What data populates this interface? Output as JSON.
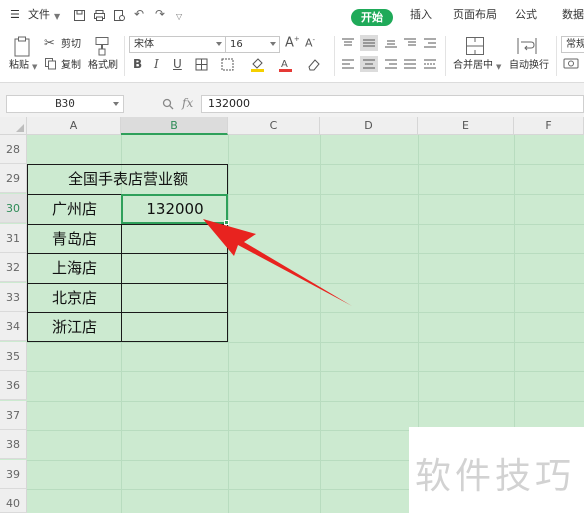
{
  "menubar": {
    "file_label": "文件",
    "tabs": [
      "开始",
      "插入",
      "页面布局",
      "公式",
      "数据"
    ]
  },
  "ribbon": {
    "paste_label": "粘贴",
    "cut_label": "剪切",
    "copy_label": "复制",
    "format_painter_label": "格式刷",
    "font_name": "宋体",
    "font_size": "16",
    "merge_center_label": "合并居中",
    "wrap_text_label": "自动换行",
    "number_format": "常规"
  },
  "formula_bar": {
    "name_box": "B30",
    "fx_label": "fx",
    "formula_value": "132000"
  },
  "columns": [
    "A",
    "B",
    "C",
    "D",
    "E",
    "F"
  ],
  "rows": [
    "28",
    "29",
    "30",
    "31",
    "32",
    "33",
    "34",
    "35",
    "36",
    "37",
    "38",
    "39",
    "40"
  ],
  "table": {
    "title": "全国手表店营业额",
    "stores": [
      "广州店",
      "青岛店",
      "上海店",
      "北京店",
      "浙江店"
    ],
    "values": [
      "132000",
      "",
      "",
      "",
      ""
    ]
  },
  "watermark": "软件技巧",
  "colors": {
    "accent": "#1faa59",
    "grid_background": "#ccead0",
    "annotation_arrow": "#e8231f"
  }
}
